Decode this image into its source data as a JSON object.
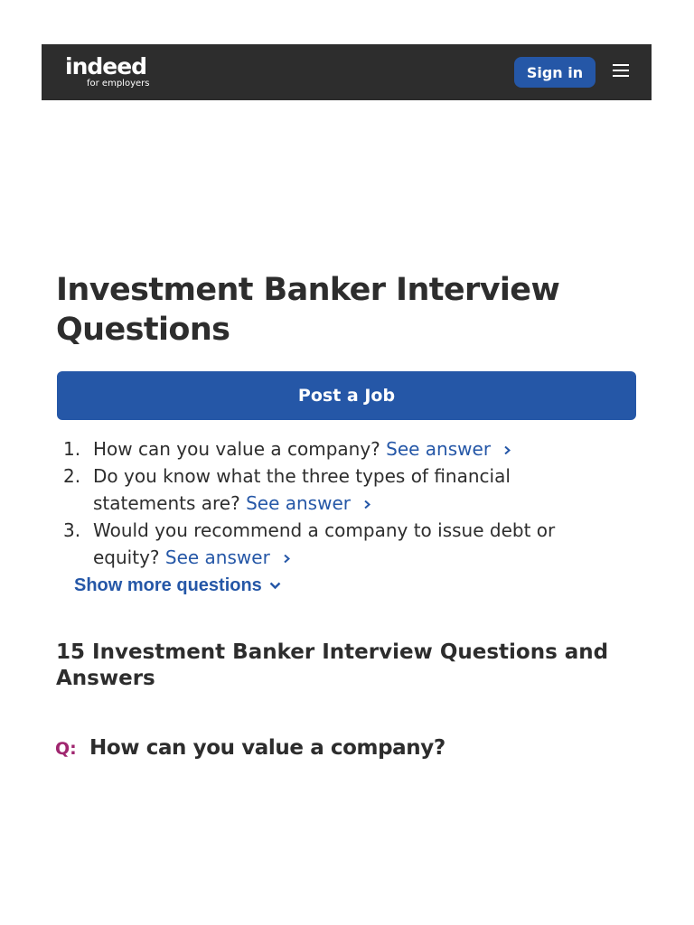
{
  "header": {
    "logo_word": "indeed",
    "logo_sub": "for employers",
    "signin_label": "Sign in",
    "menu_icon": "hamburger-menu-icon"
  },
  "main": {
    "title": "Investment Banker Interview Questions",
    "post_job_label": "Post a Job",
    "questions": [
      {
        "num": "1.",
        "text": "How can you value a company?",
        "link": "See answer"
      },
      {
        "num": "2.",
        "text": "Do you know what the three types of financial statements are?",
        "link": "See answer"
      },
      {
        "num": "3.",
        "text": "Would you recommend a company to issue debt or equity?",
        "link": "See answer"
      }
    ],
    "show_more_label": "Show more questions",
    "section_title": "15 Investment Banker Interview Questions and Answers",
    "qa": {
      "prefix": "Q:",
      "question": "How can you value a company?"
    }
  },
  "colors": {
    "header_bg": "#2d2d2d",
    "primary_button": "#2557a7",
    "link": "#2557a7",
    "q_prefix": "#a0266f"
  }
}
